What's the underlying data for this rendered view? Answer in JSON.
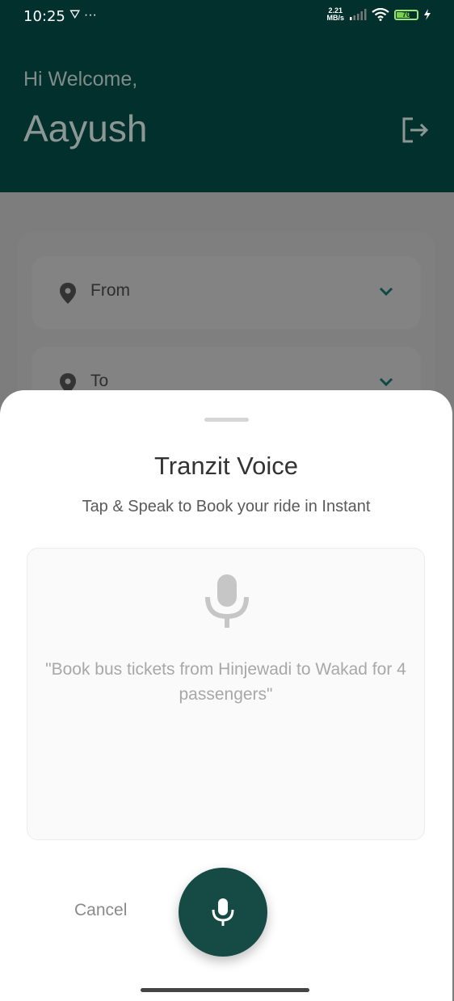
{
  "status_bar": {
    "time": "10:25",
    "left_icons": "⛛ ···",
    "speed_value": "2.21",
    "speed_unit": "MB/s",
    "battery": "70",
    "battery_level": 0.7
  },
  "header": {
    "greeting": "Hi Welcome,",
    "user_name": "Aayush"
  },
  "form": {
    "from_label": "From",
    "to_label": "To"
  },
  "sheet": {
    "title": "Tranzit Voice",
    "subtitle": "Tap & Speak  to Book your ride in Instant",
    "example": "\"Book bus tickets from Hinjewadi to Wakad for 4 passengers\"",
    "cancel_label": "Cancel"
  },
  "colors": {
    "header_bg": "#02302c",
    "accent": "#154a45",
    "chevron": "#0e4a42"
  }
}
